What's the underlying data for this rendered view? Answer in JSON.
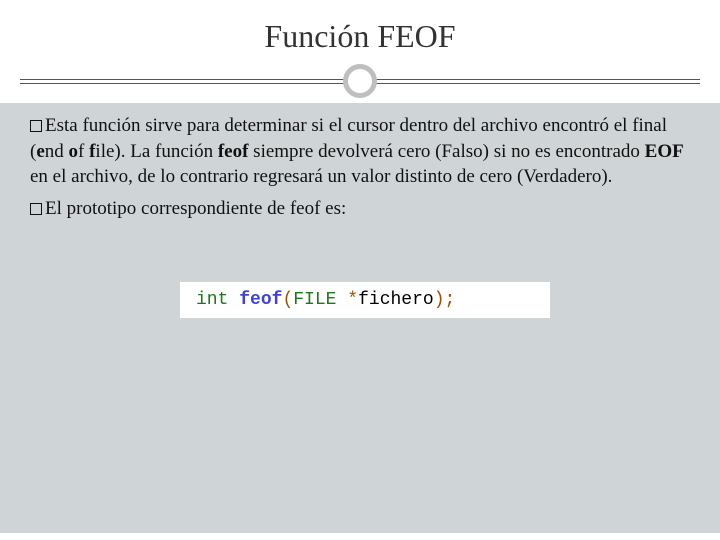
{
  "title": "Función FEOF",
  "bullets": {
    "b1": {
      "pre": "Esta función sirve para determinar si el cursor dentro del archivo encontró el final (",
      "e": "e",
      "mid1": "nd ",
      "o": "o",
      "mid2": "f ",
      "f": "f",
      "mid3": "ile). La función ",
      "feof": "feof",
      "mid4": " siempre devolverá cero (Falso) si no es encontrado ",
      "eof": "EOF",
      "tail": " en el archivo, de lo contrario regresará un valor distinto de cero (Verdadero)."
    },
    "b2": "El prototipo correspondiente de feof es:"
  },
  "code": {
    "int": "int",
    "sp1": " ",
    "func": "feof",
    "lp": "(",
    "file": "FILE",
    "sp2": " ",
    "star": "*",
    "arg": "fichero",
    "rp": ")",
    "semi": ";"
  }
}
